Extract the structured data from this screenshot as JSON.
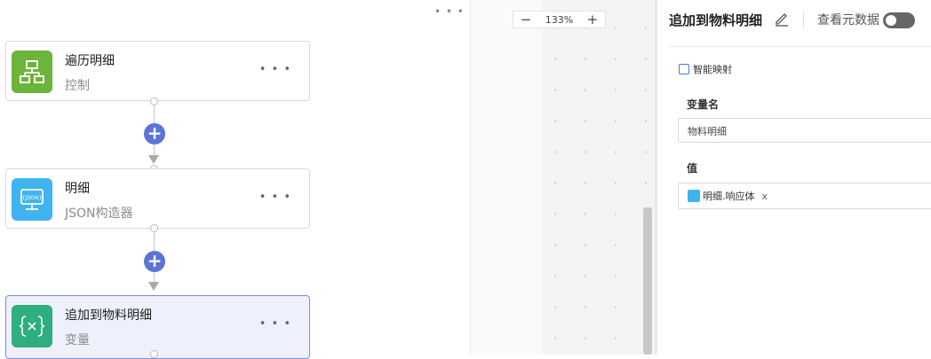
{
  "flow": {
    "top_more": "• • •",
    "nodes": [
      {
        "title": "遍历明细",
        "subtitle": "控制",
        "more": "• • •",
        "color": "#6cb43a",
        "icon": "flowchart-icon"
      },
      {
        "title": "明细",
        "subtitle": "JSON构造器",
        "more": "• • •",
        "color": "#3fb4f1",
        "icon": "json-monitor-icon"
      },
      {
        "title": "追加到物料明细",
        "subtitle": "变量",
        "more": "• • •",
        "color": "#2eaf7d",
        "icon": "variable-braces-icon"
      }
    ],
    "add_symbol": "+"
  },
  "canvas": {
    "zoom_minus": "−",
    "zoom_level": "133%",
    "zoom_plus": "+"
  },
  "panel": {
    "title": "追加到物料明细",
    "metadata_label": "查看元数据",
    "smart_mapping": "智能映射",
    "variable_name_label": "变量名",
    "variable_name_value": "物料明细",
    "value_label": "值",
    "value_chip": "明细.响应体",
    "value_chip_remove": "x"
  },
  "colors": {
    "accent": "#5b74d6",
    "active_node_bg": "#eef0fb"
  }
}
